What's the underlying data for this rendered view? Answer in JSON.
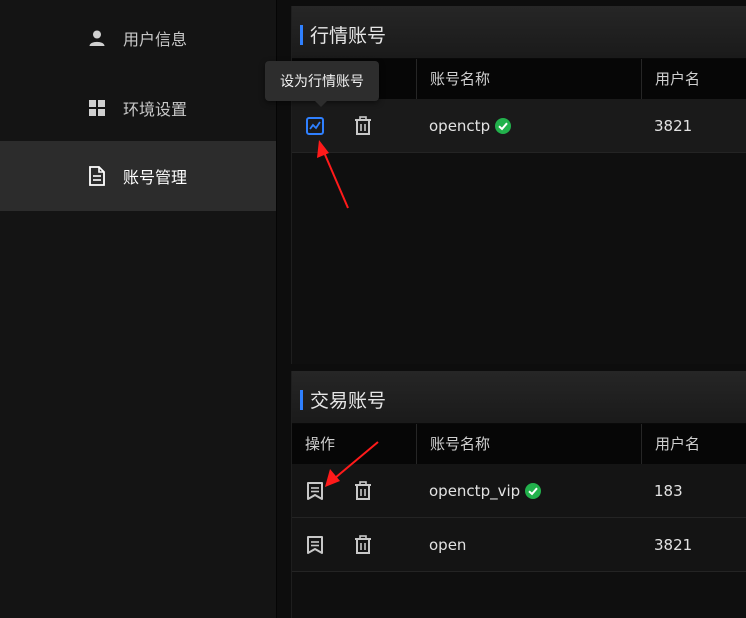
{
  "sidebar": {
    "items": [
      {
        "label": "用户信息",
        "icon": "user-icon",
        "active": false
      },
      {
        "label": "环境设置",
        "icon": "grid-icon",
        "active": false
      },
      {
        "label": "账号管理",
        "icon": "document-icon",
        "active": true
      }
    ]
  },
  "market_card": {
    "title": "行情账号",
    "columns": [
      "",
      "账号名称",
      "用户名"
    ],
    "rows": [
      {
        "account_name": "openctp",
        "username": "3821",
        "verified": true
      }
    ],
    "tooltip": "设为行情账号"
  },
  "trade_card": {
    "title": "交易账号",
    "columns": [
      "操作",
      "账号名称",
      "用户名"
    ],
    "rows": [
      {
        "account_name": "openctp_vip",
        "username": "183",
        "verified": true
      },
      {
        "account_name": "open",
        "username": "3821",
        "verified": false
      }
    ]
  },
  "colors": {
    "accent": "#2f80ff",
    "verified": "#22b14c",
    "annotation": "#ff1a1a",
    "active_nav_bg": "#2c2c2c"
  }
}
